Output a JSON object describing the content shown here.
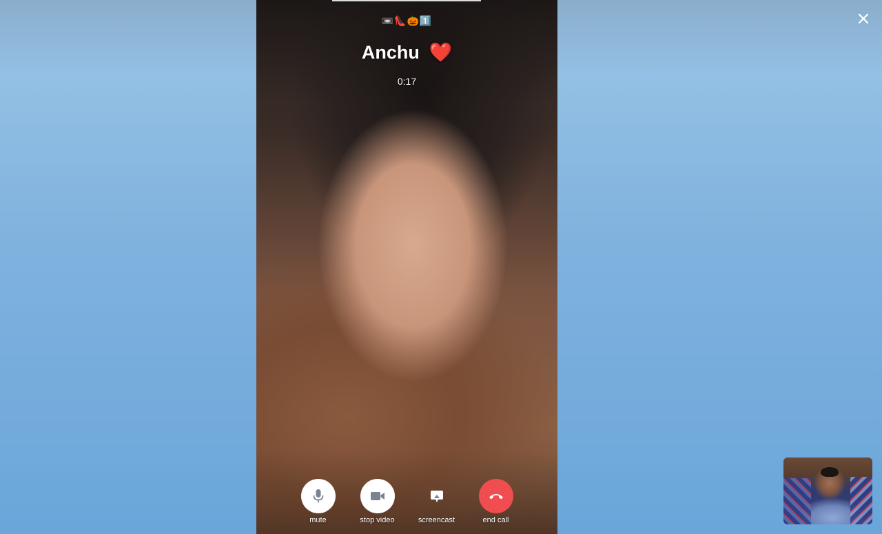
{
  "call": {
    "status_emojis": "📼👠🎃1️⃣",
    "caller_name": "Anchu",
    "caller_emoji": "❤️",
    "duration": "0:17"
  },
  "controls": {
    "mute_label": "mute",
    "stop_video_label": "stop video",
    "screencast_label": "screencast",
    "end_call_label": "end call"
  },
  "window": {
    "close_icon": "close-icon"
  },
  "colors": {
    "end_call": "#ef4d4f",
    "background_top": "#93c0e4",
    "background_bottom": "#6aa6da"
  }
}
